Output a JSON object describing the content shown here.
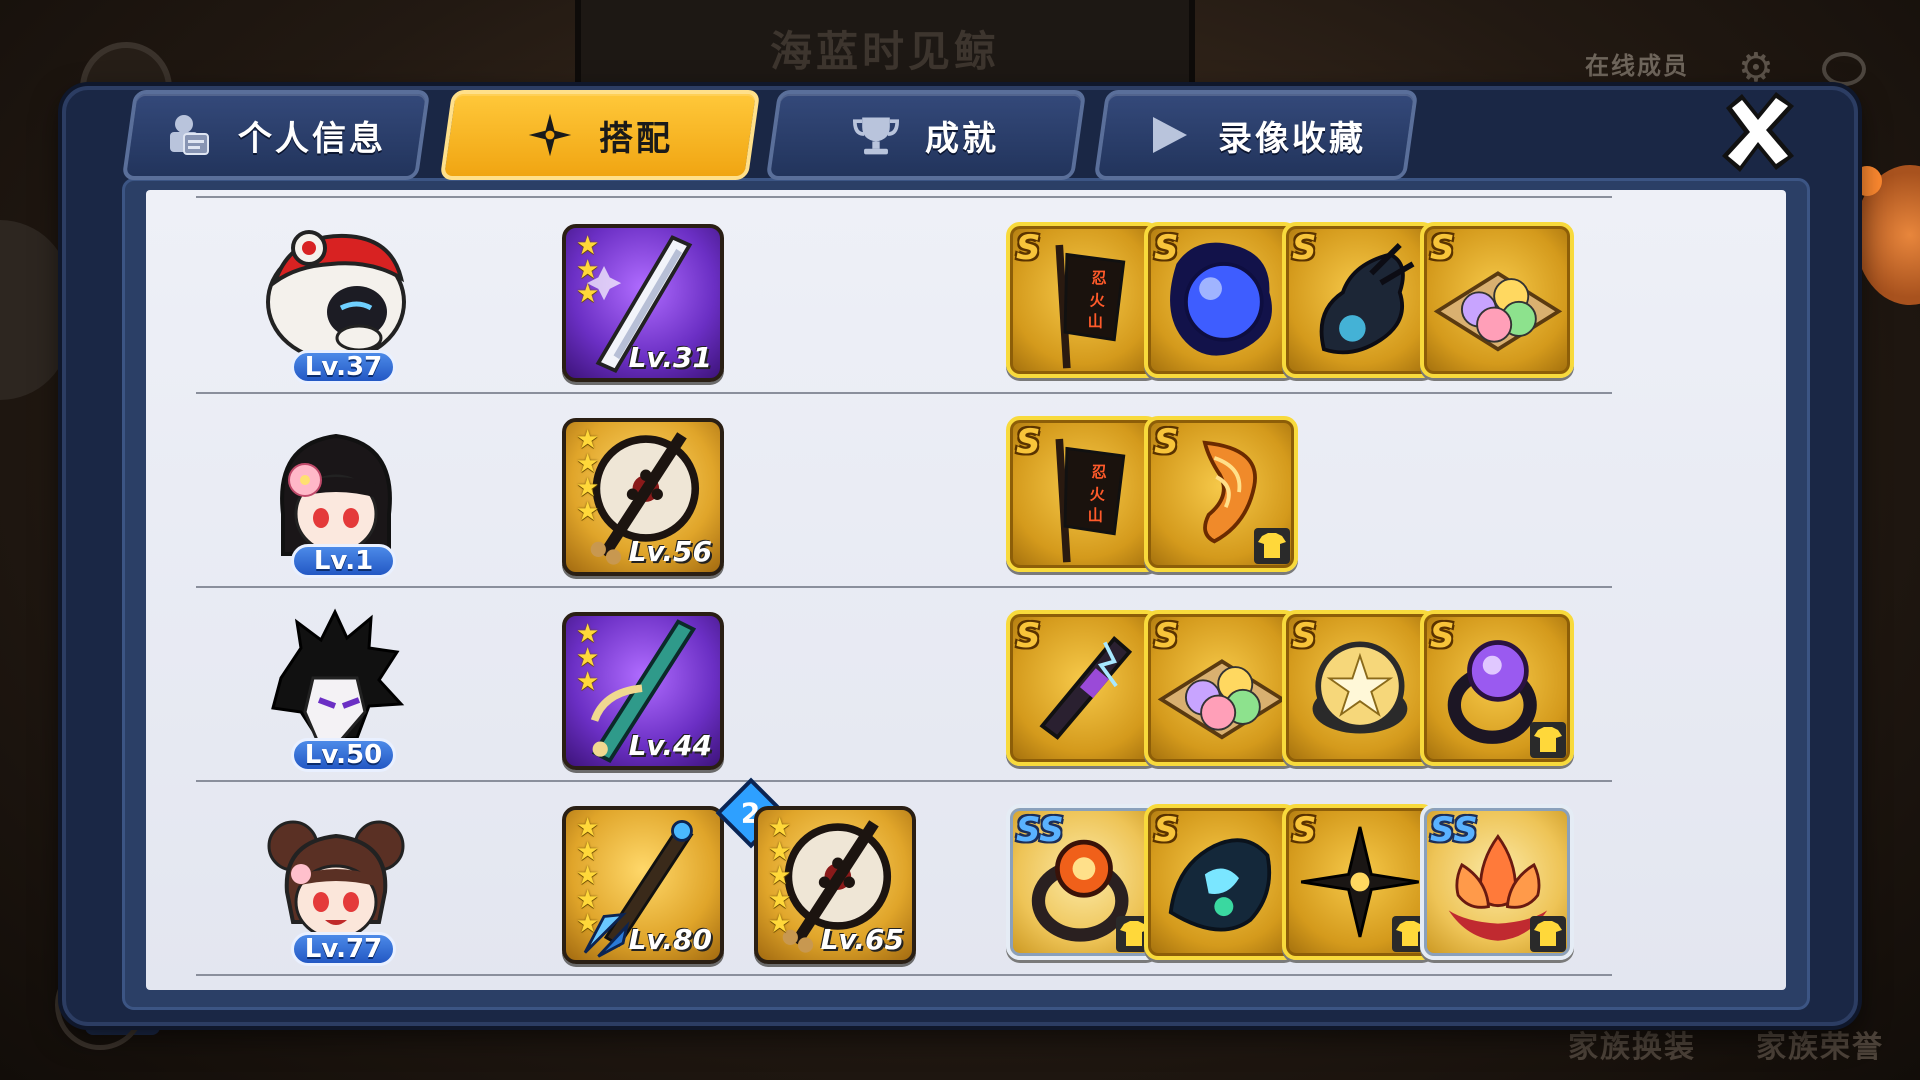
{
  "background": {
    "title": "海蓝时见鲸",
    "online_members": "在线成员",
    "bottom_labels": [
      "家族换装",
      "家族荣誉"
    ]
  },
  "tabs": [
    {
      "label": "个人信息",
      "icon": "profile-card-icon",
      "active": false
    },
    {
      "label": "搭配",
      "icon": "shuriken-icon",
      "active": true
    },
    {
      "label": "成就",
      "icon": "trophy-icon",
      "active": false
    },
    {
      "label": "录像收藏",
      "icon": "play-icon",
      "active": false
    }
  ],
  "close_icon": "close-icon",
  "rows": [
    {
      "character": "panda-hood-ninja",
      "level": "Lv.37",
      "weapons": [
        {
          "name": "phone-blade",
          "stars": 3,
          "level": "Lv.31",
          "rarity": "purple"
        }
      ],
      "items": [
        {
          "name": "war-banner",
          "rank": "S",
          "costume": false
        },
        {
          "name": "blue-orb",
          "rank": "S",
          "costume": false
        },
        {
          "name": "shadow-beast",
          "rank": "S",
          "costume": false
        },
        {
          "name": "dango-plate",
          "rank": "S",
          "costume": false
        }
      ]
    },
    {
      "character": "sakura-girl-ninja",
      "level": "Lv.1",
      "weapons": [
        {
          "name": "war-fan",
          "stars": 4,
          "level": "Lv.56",
          "rarity": "gold"
        }
      ],
      "items": [
        {
          "name": "war-banner",
          "rank": "S",
          "costume": false
        },
        {
          "name": "flame-horn",
          "rank": "S",
          "costume": true
        }
      ]
    },
    {
      "character": "fox-mask-ninja",
      "level": "Lv.50",
      "weapons": [
        {
          "name": "bamboo-flute",
          "stars": 3,
          "level": "Lv.44",
          "rarity": "purple"
        }
      ],
      "items": [
        {
          "name": "lightning-scroll",
          "rank": "S",
          "costume": false
        },
        {
          "name": "dango-plate",
          "rank": "S",
          "costume": false
        },
        {
          "name": "star-drum",
          "rank": "S",
          "costume": false
        },
        {
          "name": "violet-ring",
          "rank": "S",
          "costume": true
        }
      ]
    },
    {
      "character": "bun-hair-girl-ninja",
      "level": "Lv.77",
      "weapons": [
        {
          "name": "ice-spear",
          "stars": 5,
          "level": "Lv.80",
          "rarity": "gold",
          "badge": "2"
        },
        {
          "name": "war-fan",
          "stars": 5,
          "level": "Lv.65",
          "rarity": "gold"
        }
      ],
      "items": [
        {
          "name": "fire-ring",
          "rank": "SS",
          "costume": true
        },
        {
          "name": "blue-spirit-beast",
          "rank": "S",
          "costume": false
        },
        {
          "name": "shuriken-star",
          "rank": "S",
          "costume": true
        },
        {
          "name": "lotus-flame",
          "rank": "SS",
          "costume": true
        }
      ]
    }
  ],
  "colors": {
    "tab_active": "#f0a512",
    "tab_inactive": "#22345c",
    "panel": "#1a2745",
    "level_badge": "#2358c4",
    "item_gold": "#d49a1c"
  }
}
